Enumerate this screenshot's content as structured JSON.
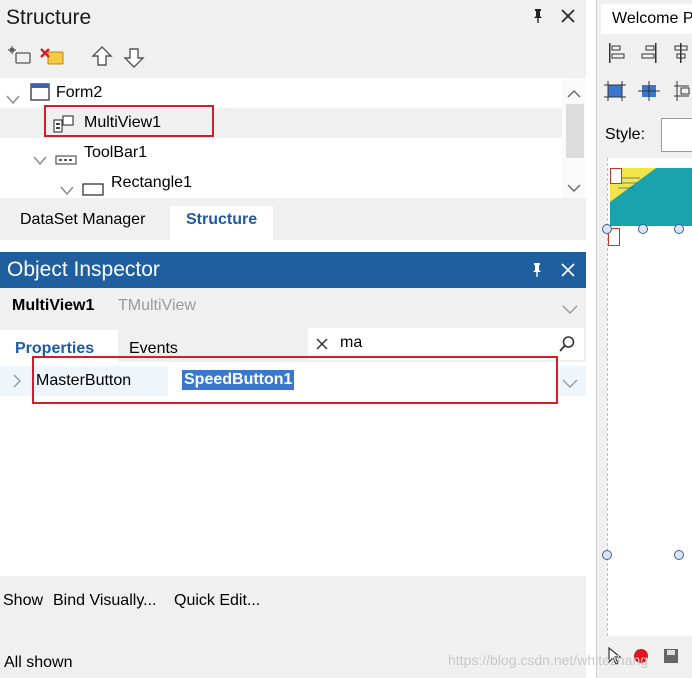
{
  "structure": {
    "title": "Structure",
    "pin_icon": "pin-icon",
    "close_icon": "close-icon",
    "tree": [
      {
        "label": "Form2",
        "icon": "form-icon",
        "expanded": true
      },
      {
        "label": "MultiView1",
        "icon": "multiview-icon",
        "selected": true
      },
      {
        "label": "ToolBar1",
        "icon": "toolbar-icon",
        "expanded": true
      },
      {
        "label": "Rectangle1",
        "icon": "rectangle-icon",
        "expanded": true
      }
    ],
    "tabs": [
      "DataSet Manager",
      "Structure"
    ],
    "active_tab": "Structure"
  },
  "inspector": {
    "title": "Object Inspector",
    "object_name": "MultiView1",
    "object_type": "TMultiView",
    "tabs": [
      "Properties",
      "Events"
    ],
    "active_tab": "Properties",
    "search_value": "ma",
    "property": {
      "name": "MasterButton",
      "value": "SpeedButton1"
    },
    "footer_links": [
      "Show",
      "Bind Visually...",
      "Quick Edit..."
    ],
    "status": "All shown"
  },
  "right": {
    "tab_label": "Welcome Page",
    "style_label": "Style:"
  },
  "colors": {
    "accent": "#1f5fa0",
    "active_tab_text": "#1f5aa6",
    "selection": "#3a78d0",
    "highlight_box": "#d51c2a"
  },
  "watermark": "https://blog.csdn.net/whitezhang"
}
